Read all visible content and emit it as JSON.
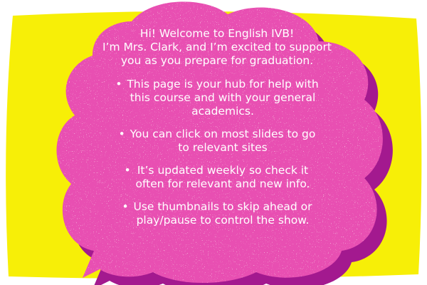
{
  "colors": {
    "background_card": "#f7ef07",
    "bubble_fill": "#e84fb2",
    "bubble_shadow": "#a3198f",
    "text": "#ffffff"
  },
  "message": {
    "intro": [
      "Hi! Welcome to English IVB!",
      "I’m Mrs. Clark, and I’m excited to support",
      "you as you prepare for graduation."
    ],
    "bullet_glyph": "•",
    "bullets": [
      [
        "This page is your hub for help with",
        "this course and with your general",
        "academics."
      ],
      [
        "You can click on most slides to go",
        "to relevant sites"
      ],
      [
        "It’s updated weekly so check it",
        "often for relevant and new info."
      ],
      [
        "Use thumbnails to skip ahead or",
        "play/pause to control the show."
      ]
    ]
  }
}
